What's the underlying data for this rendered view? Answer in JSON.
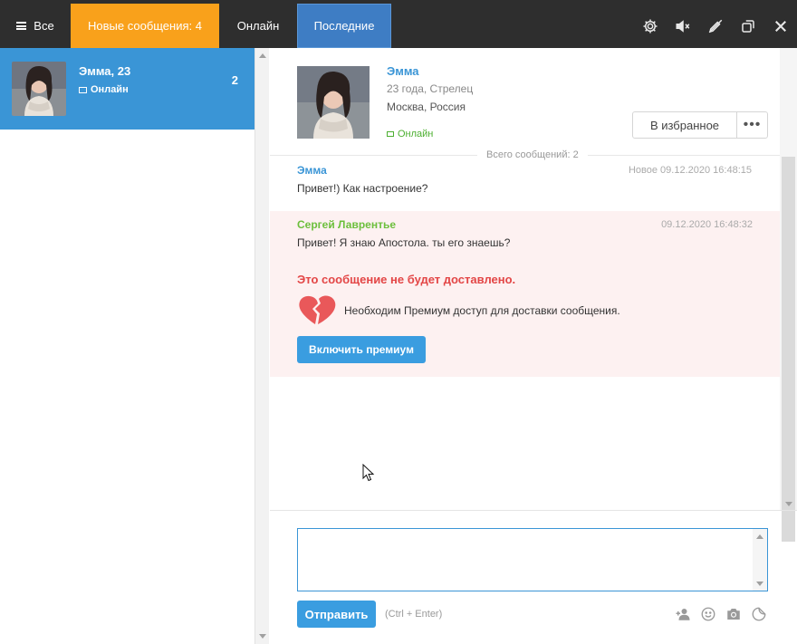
{
  "tabs": {
    "all": "Все",
    "new_messages": "Новые сообщения: 4",
    "online": "Онлайн",
    "recent": "Последние"
  },
  "top_icons": [
    "gear-icon",
    "mute-icon",
    "no-edit-icon",
    "restore-window-icon",
    "close-icon"
  ],
  "contact": {
    "name": "Эмма, 23",
    "status": "Онлайн",
    "unread": "2"
  },
  "profile": {
    "name": "Эмма",
    "age_sign": "23 года, Стрелец",
    "city": "Москва, Россия",
    "status": "Онлайн",
    "favorite_label": "В избранное",
    "more_label": "•••"
  },
  "total_messages": "Всего сообщений: 2",
  "messages": [
    {
      "author": "Эмма",
      "time": "Новое 09.12.2020 16:48:15",
      "text": "Привет!) Как настроение?"
    },
    {
      "author": "Сергей Лаврентье",
      "time": "09.12.2020 16:48:32",
      "text": "Привет! Я знаю Апостола. ты его знаешь?",
      "warning": "Это сообщение не будет доставлено.",
      "note": "Необходим Премиум доступ для доставки сообщения.",
      "premium_label": "Включить премиум"
    }
  ],
  "composer": {
    "value": "",
    "send_label": "Отправить",
    "hint": "(Ctrl + Enter)"
  },
  "tool_icons": [
    "add-user-icon",
    "smile-icon",
    "camera-icon",
    "sticker-icon"
  ],
  "colors": {
    "accent": "#3a95d6",
    "new_tab": "#f9a11b",
    "topbar": "#2e2e2e",
    "warning": "#e34646",
    "online": "#4caf30"
  }
}
